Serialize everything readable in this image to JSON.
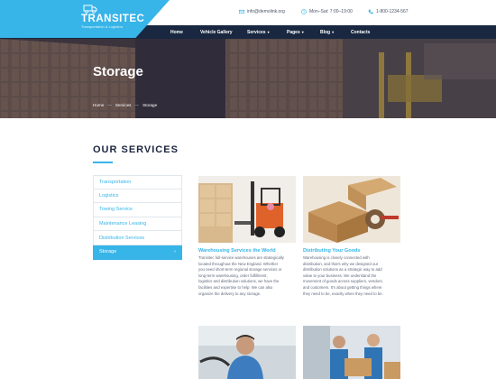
{
  "brand": {
    "name": "TRANSITEC",
    "tagline": "Transportation & Logistics",
    "accent_color": "#37b4e8",
    "nav_color": "#192840"
  },
  "contacts": {
    "email": "info@demolink.org",
    "hours": "Mon–Sat: 7:00–19:00",
    "phone": "1-800-1234-567"
  },
  "nav": {
    "home": "Home",
    "vehicle_gallery": "Vehicle Gallery",
    "services": "Services",
    "pages": "Pages",
    "blog": "Blog",
    "contacts": "Contacts"
  },
  "hero": {
    "title": "Storage",
    "breadcrumb": [
      "Home",
      "Services",
      "Storage"
    ]
  },
  "section": {
    "title": "OUR SERVICES"
  },
  "sidebar": {
    "items": [
      {
        "label": "Transportation"
      },
      {
        "label": "Logistics"
      },
      {
        "label": "Towing Service"
      },
      {
        "label": "Maintenance Leasing"
      },
      {
        "label": "Distribution Services"
      },
      {
        "label": "Storage",
        "active": true
      }
    ]
  },
  "cards": [
    {
      "title": "Warehousing Services the World",
      "lines": [
        "Transitec full-service warehouses are strategically",
        "located throughout the New England. Whether",
        "you need short-term regional storage services or",
        "long-term warehousing, order fulfillment,",
        "logistics and distribution solutions, we have the",
        "facilities and expertise to help. We can also",
        "organize the delivery to any storage."
      ]
    },
    {
      "title": "Distributing Your Goods",
      "lines": [
        "Warehousing is closely connected with",
        "distribution, and that's why we designed our",
        "distribution solutions as a strategic way to add",
        "value to your business. We understand the",
        "movement of goods across suppliers, vendors,",
        "and customers. It's about getting things where",
        "they need to be, exactly when they need to be."
      ]
    }
  ]
}
